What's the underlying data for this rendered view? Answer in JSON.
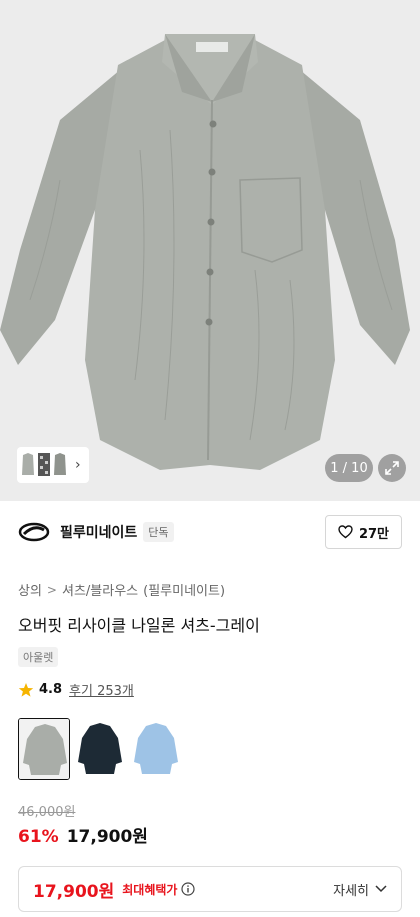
{
  "gallery": {
    "counter": "1 / 10",
    "thumb_next": "›"
  },
  "brand": {
    "name": "필루미네이트",
    "tag": "단독"
  },
  "likes": {
    "count": "27만"
  },
  "breadcrumb": {
    "items": [
      "상의",
      "셔츠/블라우스",
      "(필루미네이트)"
    ],
    "separator": ">"
  },
  "product": {
    "title": "오버핏 리사이클 나일론 셔츠-그레이",
    "label": "아울렛"
  },
  "rating": {
    "score": "4.8",
    "reviews": "후기 253개"
  },
  "colors": {
    "options": [
      "gray",
      "navy",
      "light-blue"
    ],
    "selected": "gray",
    "swatch_colors": {
      "gray": "#a9ada8",
      "navy": "#1d2a35",
      "light-blue": "#9ec3e6"
    }
  },
  "price": {
    "original": "46,000원",
    "discount": "61%",
    "sale": "17,900원"
  },
  "benefit": {
    "price": "17,900원",
    "label": "최대혜택가",
    "detail": "자세히"
  },
  "theme": {
    "accent": "#e8141d",
    "star": "#f5b400"
  }
}
